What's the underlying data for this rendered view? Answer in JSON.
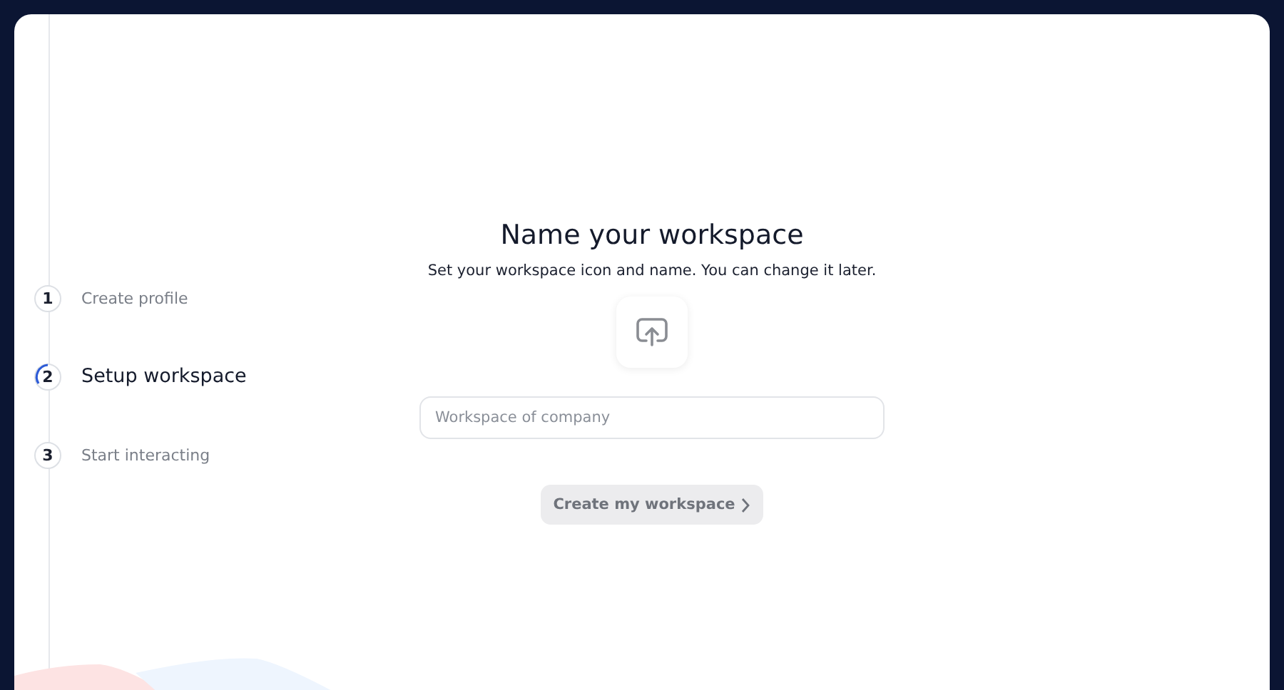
{
  "steps": [
    {
      "number": "1",
      "label": "Create profile",
      "selected": false
    },
    {
      "number": "2",
      "label": "Setup workspace",
      "selected": true
    },
    {
      "number": "3",
      "label": "Start interacting",
      "selected": false
    }
  ],
  "heading": "Name your workspace",
  "subheading": "Set your workspace icon and name. You can change it later.",
  "name_field": {
    "placeholder": "Workspace of company"
  },
  "submit_button": {
    "label": "Create my workspace",
    "disabled": true
  }
}
